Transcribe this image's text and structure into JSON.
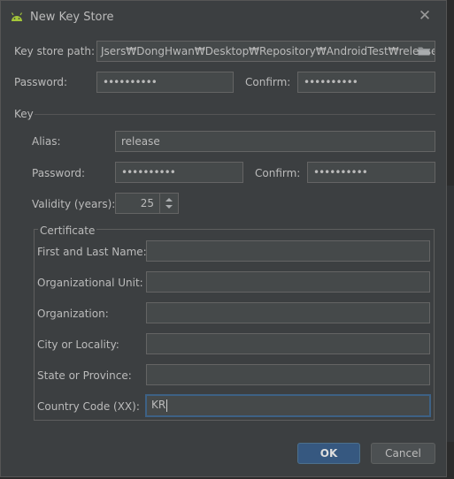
{
  "dialog": {
    "title": "New Key Store",
    "icon": "android-icon",
    "close_icon": "close-icon"
  },
  "keystore": {
    "path_label": "Key store path:",
    "path_value": "Jsers₩DongHwan₩Desktop₩Repository₩AndroidTest₩release.jks",
    "folder_icon": "folder-icon",
    "password_label": "Password:",
    "password_value": "••••••••••",
    "confirm_label": "Confirm:",
    "confirm_value": "••••••••••"
  },
  "key": {
    "section_label": "Key",
    "alias_label": "Alias:",
    "alias_value": "release",
    "password_label": "Password:",
    "password_value": "••••••••••",
    "confirm_label": "Confirm:",
    "confirm_value": "••••••••••",
    "validity_label": "Validity (years):",
    "validity_value": "25"
  },
  "certificate": {
    "section_label": "Certificate",
    "first_last_label": "First and Last Name:",
    "first_last_value": "",
    "org_unit_label": "Organizational Unit:",
    "org_unit_value": "",
    "org_label": "Organization:",
    "org_value": "",
    "city_label": "City or Locality:",
    "city_value": "",
    "state_label": "State or Province:",
    "state_value": "",
    "country_label": "Country Code (XX):",
    "country_value": "KR"
  },
  "buttons": {
    "ok": "OK",
    "cancel": "Cancel"
  },
  "colors": {
    "background": "#3c3f41",
    "field": "#45494a",
    "accent": "#365880",
    "focus": "#3d6185",
    "android": "#a4c639"
  }
}
